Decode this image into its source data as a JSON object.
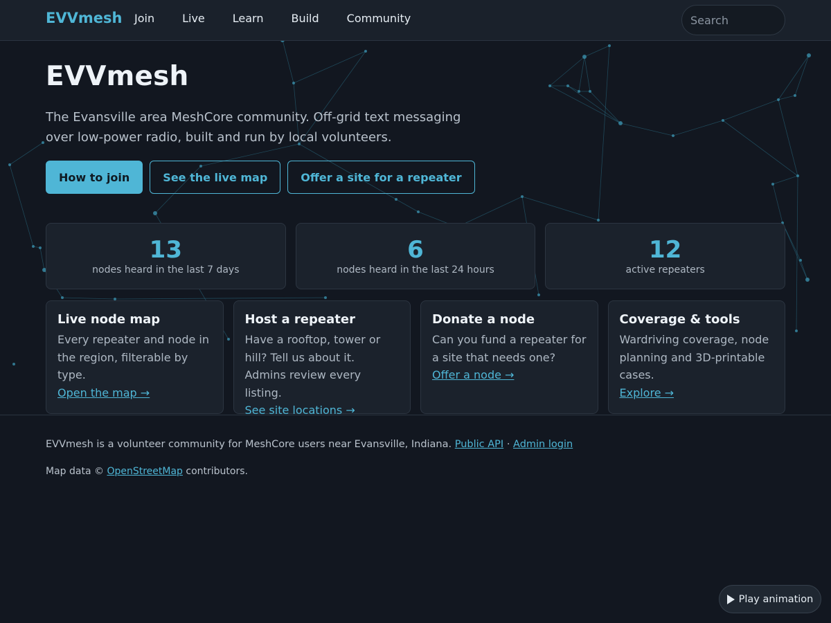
{
  "header": {
    "brand": "EVVmesh",
    "nav": [
      "Join",
      "Live",
      "Learn",
      "Build",
      "Community"
    ],
    "search_placeholder": "Search"
  },
  "hero": {
    "title": "EVVmesh",
    "subtitle": "The Evansville area MeshCore community. Off-grid text messaging over low-power radio, built and run by local volunteers.",
    "buttons": [
      "How to join",
      "See the live map",
      "Offer a site for a repeater"
    ]
  },
  "stats": [
    {
      "value": "13",
      "label": "nodes heard in the last 7 days"
    },
    {
      "value": "6",
      "label": "nodes heard in the last 24 hours"
    },
    {
      "value": "12",
      "label": "active repeaters"
    }
  ],
  "cards": [
    {
      "title": "Live node map",
      "body": "Every repeater and node in the region, filterable by type.",
      "link": "Open the map →"
    },
    {
      "title": "Host a repeater",
      "body": "Have a rooftop, tower or hill? Tell us about it. Admins review every listing.",
      "link": "See site locations →"
    },
    {
      "title": "Donate a node",
      "body": "Can you fund a repeater for a site that needs one?",
      "link": "Offer a node →"
    },
    {
      "title": "Coverage & tools",
      "body": "Wardriving coverage, node planning and 3D-printable cases.",
      "link": "Explore →"
    }
  ],
  "footer": {
    "line1_text": "EVVmesh is a volunteer community for MeshCore users near Evansville, Indiana.",
    "api_link": "Public API",
    "separator": "·",
    "admin_link": "Admin login",
    "line2_prefix": "Map data ©",
    "osm_link": "OpenStreetMap",
    "line2_suffix": "contributors."
  },
  "play_button": "Play animation",
  "colors": {
    "accent": "#4fb6d6",
    "background": "#121720",
    "card": "#1b222c"
  }
}
